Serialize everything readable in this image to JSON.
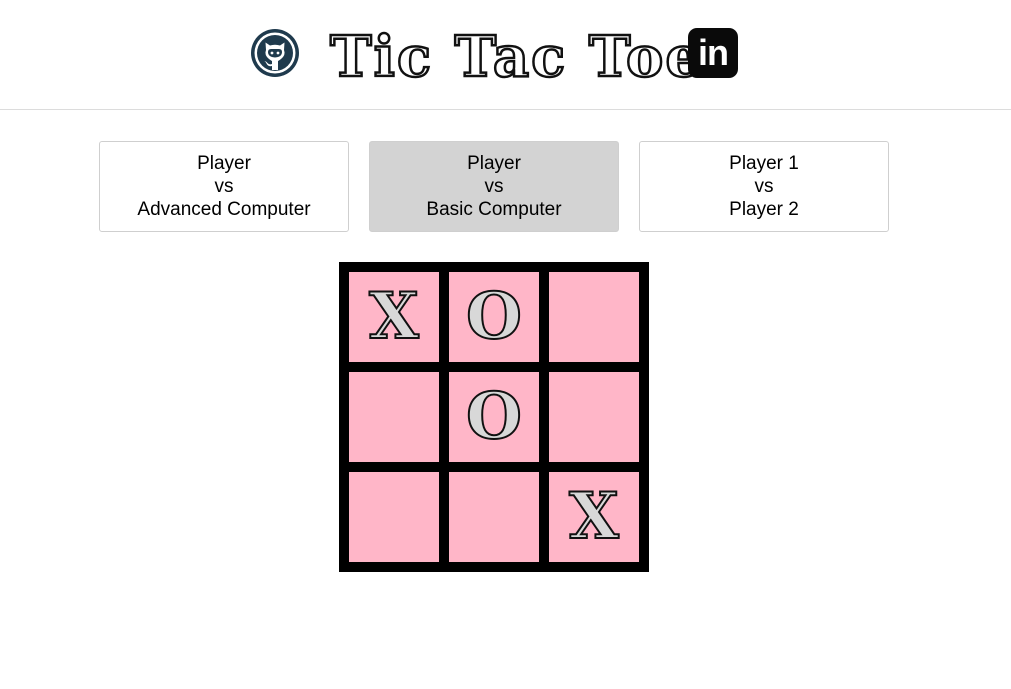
{
  "header": {
    "title": "Tic Tac Toe",
    "github_icon": "github-icon",
    "linkedin_icon": "linkedin-icon",
    "linkedin_text": "in"
  },
  "modes": [
    {
      "line1": "Player",
      "line2": "vs",
      "line3": "Advanced Computer",
      "selected": false
    },
    {
      "line1": "Player",
      "line2": "vs",
      "line3": "Basic Computer",
      "selected": true
    },
    {
      "line1": "Player 1",
      "line2": "vs",
      "line3": "Player 2",
      "selected": false
    }
  ],
  "board": {
    "cells": [
      "X",
      "O",
      "",
      "",
      "O",
      "",
      "",
      "",
      "X"
    ]
  },
  "colors": {
    "cell_background": "#ffb6c8",
    "board_border": "#000000",
    "selected_mode": "#d3d3d3"
  }
}
